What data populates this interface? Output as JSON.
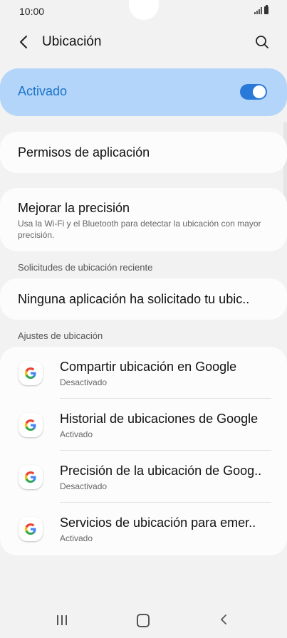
{
  "status_bar": {
    "time": "10:00"
  },
  "header": {
    "title": "Ubicación"
  },
  "master_switch": {
    "label": "Activado",
    "state": "on"
  },
  "permissions": {
    "label": "Permisos de aplicación"
  },
  "precision": {
    "title": "Mejorar la precisión",
    "subtitle": "Usa la Wi-Fi y el Bluetooth para detectar la ubicación con mayor precisión."
  },
  "recent_requests": {
    "header": "Solicitudes de ubicación reciente",
    "message": "Ninguna aplicación ha solicitado tu ubic.."
  },
  "location_settings": {
    "header": "Ajustes de ubicación",
    "items": [
      {
        "title": "Compartir ubicación en Google",
        "status": "Desactivado",
        "icon": "google-icon"
      },
      {
        "title": "Historial de ubicaciones de Google",
        "status": "Activado",
        "icon": "google-icon"
      },
      {
        "title": "Precisión de la ubicación de Goog..",
        "status": "Desactivado",
        "icon": "google-icon"
      },
      {
        "title": "Servicios de ubicación para emer..",
        "status": "Activado",
        "icon": "google-icon"
      }
    ]
  },
  "colors": {
    "accent": "#2979d9",
    "master_bg": "#b3d5f9",
    "master_text": "#1a73c9",
    "background": "#f2f2f2",
    "card": "#fcfcfc"
  }
}
